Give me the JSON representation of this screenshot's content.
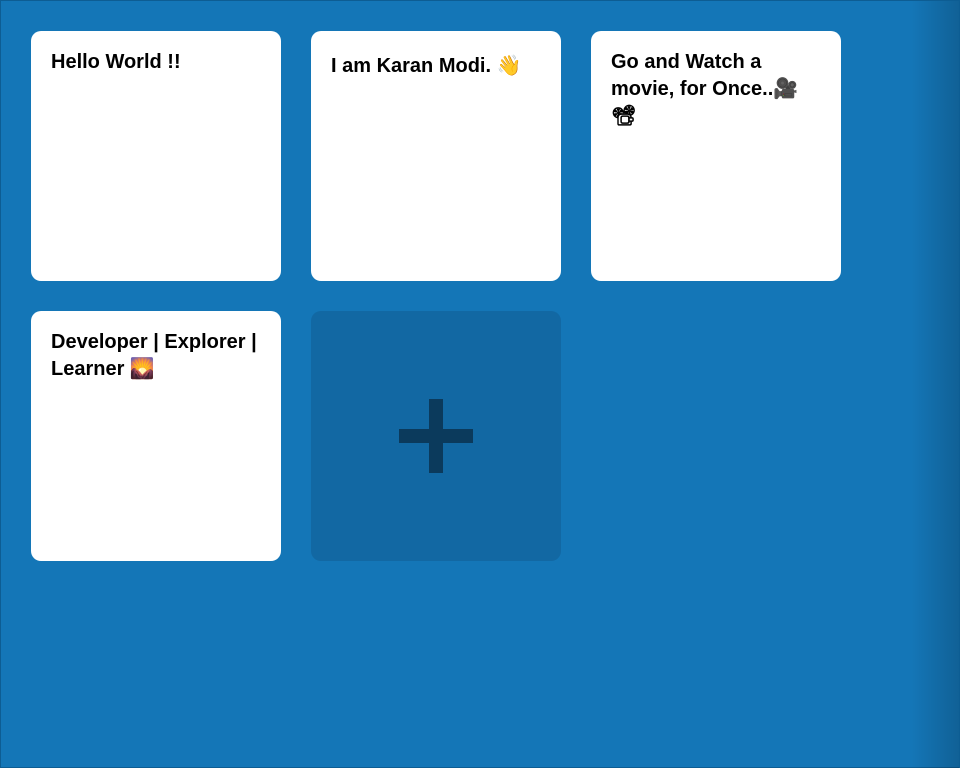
{
  "notes": [
    {
      "text": "Hello World !!"
    },
    {
      "text": "I am Karan Modi. 👋"
    },
    {
      "text": "Go and Watch a movie, for Once..🎥 📽"
    },
    {
      "text": "Developer | Explorer | Learner 🌄"
    }
  ],
  "add_button": {
    "icon": "plus-icon"
  },
  "colors": {
    "background": "#1476b7",
    "note": "#ffffff",
    "add_card": "#1268a3",
    "plus": "#0b3a5c"
  }
}
